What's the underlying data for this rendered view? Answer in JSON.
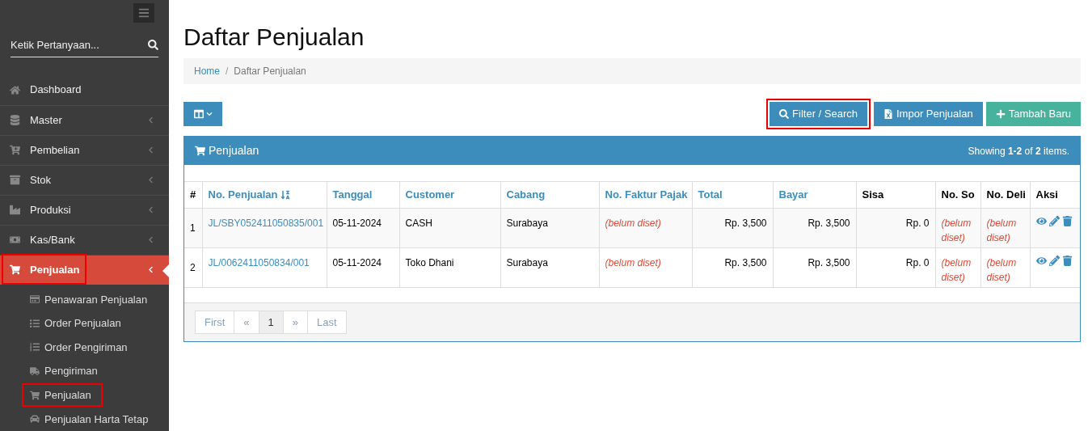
{
  "sidebar": {
    "search": {
      "placeholder": "Ketik Pertanyaan..."
    },
    "items": [
      {
        "label": "Dashboard",
        "expandable": false,
        "selected": false,
        "highlighted": false
      },
      {
        "label": "Master",
        "expandable": true,
        "selected": false,
        "highlighted": false
      },
      {
        "label": "Pembelian",
        "expandable": true,
        "selected": false,
        "highlighted": false
      },
      {
        "label": "Stok",
        "expandable": true,
        "selected": false,
        "highlighted": false
      },
      {
        "label": "Produksi",
        "expandable": true,
        "selected": false,
        "highlighted": false
      },
      {
        "label": "Kas/Bank",
        "expandable": true,
        "selected": false,
        "highlighted": false
      },
      {
        "label": "Penjualan",
        "expandable": true,
        "selected": true,
        "highlighted": true,
        "children": [
          {
            "label": "Penawaran Penjualan",
            "highlighted": false
          },
          {
            "label": "Order Penjualan",
            "highlighted": false
          },
          {
            "label": "Order Pengiriman",
            "highlighted": false
          },
          {
            "label": "Pengiriman",
            "highlighted": false
          },
          {
            "label": "Penjualan",
            "highlighted": true
          },
          {
            "label": "Penjualan Harta Tetap",
            "highlighted": false
          }
        ]
      }
    ]
  },
  "page_title": "Daftar Penjualan",
  "breadcrumb": {
    "separator": "/",
    "items": [
      {
        "label": "Home",
        "link": true
      },
      {
        "label": "Daftar Penjualan",
        "link": false
      }
    ]
  },
  "toolbar": [
    {
      "label": "Filter / Search",
      "kind": "primary",
      "highlighted": true
    },
    {
      "label": "Impor Penjualan",
      "kind": "primary",
      "highlighted": false
    },
    {
      "label": "Tambah Baru",
      "kind": "success",
      "highlighted": false
    }
  ],
  "panel": {
    "title": "Penjualan",
    "summary": "Showing **1-2** of **2** items."
  },
  "table": {
    "columns": [
      {
        "label": "#",
        "sortable": false,
        "sorted": false
      },
      {
        "label": "No. Penjualan",
        "sortable": true,
        "sorted": true
      },
      {
        "label": "Tanggal",
        "sortable": true,
        "sorted": false
      },
      {
        "label": "Customer",
        "sortable": true,
        "sorted": false
      },
      {
        "label": "Cabang",
        "sortable": true,
        "sorted": false
      },
      {
        "label": "No. Faktur Pajak",
        "sortable": true,
        "sorted": false
      },
      {
        "label": "Total",
        "sortable": true,
        "sorted": false
      },
      {
        "label": "Bayar",
        "sortable": true,
        "sorted": false
      },
      {
        "label": "Sisa",
        "sortable": false,
        "sorted": false
      },
      {
        "label": "No. So",
        "sortable": false,
        "sorted": false
      },
      {
        "label": "No. Deli",
        "sortable": false,
        "sorted": false
      },
      {
        "label": "Aksi",
        "sortable": false,
        "sorted": false
      }
    ],
    "rows": [
      {
        "cells": [
          {
            "kind": "index",
            "text": "1"
          },
          {
            "kind": "link",
            "text": "JL/SBY052411050835/001"
          },
          {
            "kind": "text",
            "text": "05-11-2024"
          },
          {
            "kind": "text",
            "text": "CASH"
          },
          {
            "kind": "text",
            "text": "Surabaya"
          },
          {
            "kind": "unset",
            "text": "(belum diset)"
          },
          {
            "kind": "amount",
            "text": "Rp. 3,500"
          },
          {
            "kind": "amount",
            "text": "Rp. 3,500"
          },
          {
            "kind": "amount",
            "text": "Rp. 0"
          },
          {
            "kind": "unset",
            "text": "(belum diset)"
          },
          {
            "kind": "unset",
            "text": "(belum diset)"
          },
          {
            "kind": "actions"
          }
        ]
      },
      {
        "cells": [
          {
            "kind": "index",
            "text": "2"
          },
          {
            "kind": "link",
            "text": "JL/0062411050834/001"
          },
          {
            "kind": "text",
            "text": "05-11-2024"
          },
          {
            "kind": "text",
            "text": "Toko Dhani"
          },
          {
            "kind": "text",
            "text": "Surabaya"
          },
          {
            "kind": "unset",
            "text": "(belum diset)"
          },
          {
            "kind": "amount",
            "text": "Rp. 3,500"
          },
          {
            "kind": "amount",
            "text": "Rp. 3,500"
          },
          {
            "kind": "amount",
            "text": "Rp. 0"
          },
          {
            "kind": "unset",
            "text": "(belum diset)"
          },
          {
            "kind": "unset",
            "text": "(belum diset)"
          },
          {
            "kind": "actions"
          }
        ]
      }
    ]
  },
  "pagination": [
    {
      "label": "First",
      "selected": false
    },
    {
      "label": "«",
      "selected": false
    },
    {
      "label": "1",
      "selected": true
    },
    {
      "label": "»",
      "selected": false
    },
    {
      "label": "Last",
      "selected": false
    }
  ]
}
